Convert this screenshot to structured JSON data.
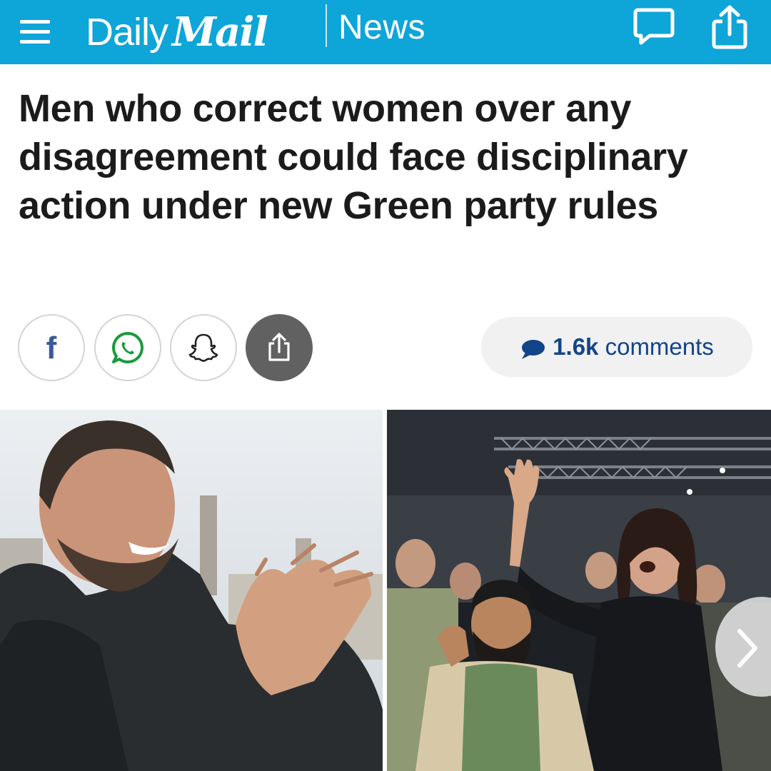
{
  "header": {
    "logo_daily": "Daily",
    "logo_mail": "Mail",
    "section": "News",
    "bar_color": "#0ea5d8",
    "icons": [
      "menu-icon",
      "comment-icon",
      "share-icon"
    ]
  },
  "article": {
    "headline": "Men who correct women over any disagreement could face disciplinary action under new Green party rules"
  },
  "share_bar": {
    "buttons": [
      "facebook",
      "whatsapp",
      "snapchat",
      "share"
    ],
    "facebook_glyph": "f",
    "comments_count": "1.6k",
    "comments_label": "comments"
  },
  "gallery": {
    "images": [
      "smiling-bearded-man-clapping",
      "cheering-crowd-at-conference"
    ],
    "next_icon": "chevron-right-icon"
  }
}
